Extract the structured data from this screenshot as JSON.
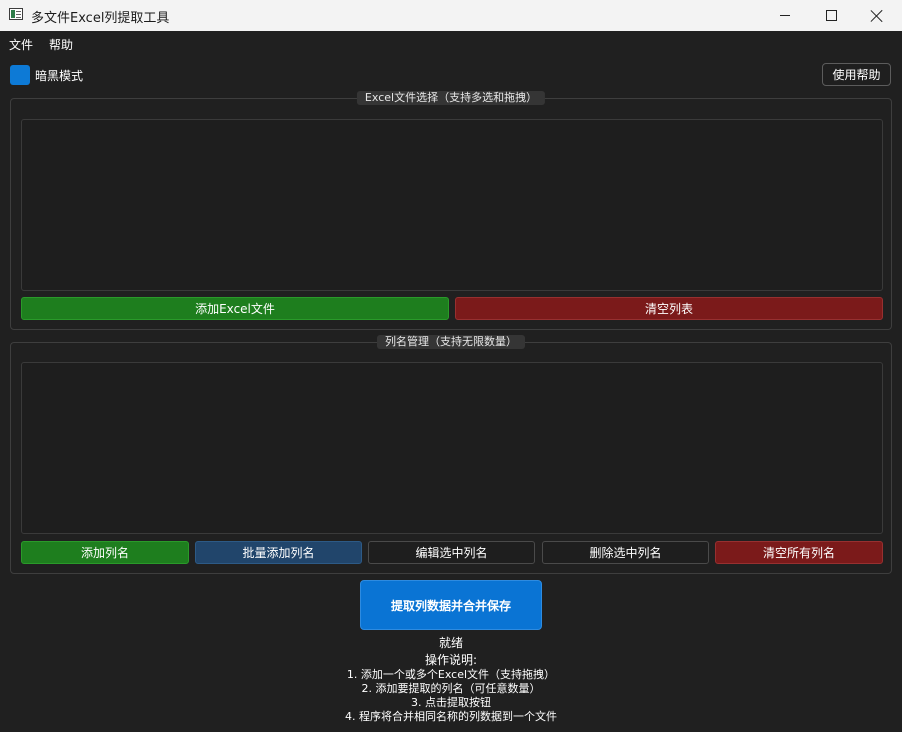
{
  "window": {
    "title": "多文件Excel列提取工具"
  },
  "menu": [
    "文件",
    "帮助"
  ],
  "toolbar": {
    "dark_mode_label": "暗黑模式",
    "help_button": "使用帮助"
  },
  "file_group": {
    "title": "Excel文件选择（支持多选和拖拽）",
    "add_button": "添加Excel文件",
    "clear_button": "清空列表"
  },
  "column_group": {
    "title": "列名管理（支持无限数量）",
    "buttons": [
      "添加列名",
      "批量添加列名",
      "编辑选中列名",
      "删除选中列名",
      "清空所有列名"
    ]
  },
  "extract_button": "提取列数据并合并保存",
  "status": "就绪",
  "instructions": {
    "title": "操作说明:",
    "lines": [
      "1. 添加一个或多个Excel文件（支持拖拽）",
      "2. 添加要提取的列名（可任意数量）",
      "3. 点击提取按钮",
      "4. 程序将合并相同名称的列数据到一个文件"
    ]
  },
  "colors": {
    "green": "#1e7e1e",
    "red": "#7b1a1a",
    "blue": "#21456b",
    "accent": "#0a74d4",
    "background": "#202020"
  }
}
